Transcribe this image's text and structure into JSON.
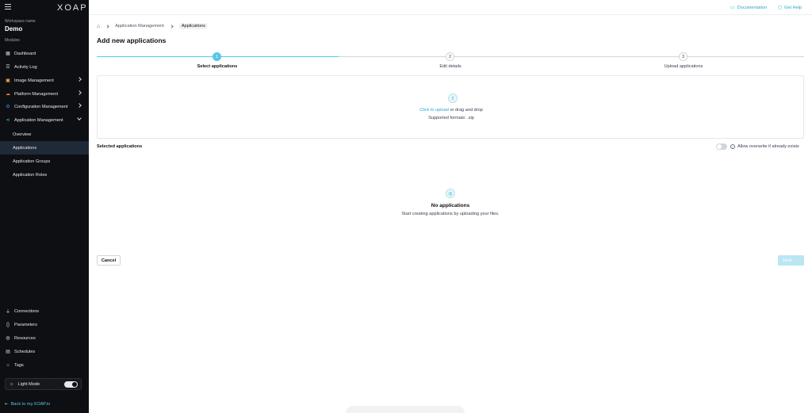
{
  "sidebar": {
    "logo": "XOAP",
    "workspace_label": "Workspace name",
    "workspace_name": "Demo",
    "modules_label": "Modules",
    "items": [
      {
        "label": "Dashboard",
        "icon": "grid-icon"
      },
      {
        "label": "Activity Log",
        "icon": "list-icon"
      },
      {
        "label": "Image Management",
        "icon": "image-icon"
      },
      {
        "label": "Platform Management",
        "icon": "cloud-icon"
      },
      {
        "label": "Configuration Management",
        "icon": "gear-icon"
      },
      {
        "label": "Application Management",
        "icon": "share-icon"
      }
    ],
    "sub_items": [
      "Overview",
      "Applications",
      "Application Groups",
      "Application Roles"
    ],
    "bottom_items": [
      {
        "label": "Connections",
        "icon": "plug-icon"
      },
      {
        "label": "Parameters",
        "icon": "brackets-icon"
      },
      {
        "label": "Resources",
        "icon": "globe-icon"
      },
      {
        "label": "Schedules",
        "icon": "calendar-icon"
      },
      {
        "label": "Tags",
        "icon": "tag-icon"
      }
    ],
    "light_mode_label": "Light Mode",
    "back_link": "Back to my.XOAP.io"
  },
  "topbar": {
    "documentation": "Documentation",
    "get_help": "Get Help"
  },
  "breadcrumb": {
    "items": [
      "Application Management",
      "Applications"
    ]
  },
  "page": {
    "title": "Add new applications"
  },
  "steps": [
    {
      "number": "1",
      "label": "Select applications"
    },
    {
      "number": "2",
      "label": "Edit details"
    },
    {
      "number": "3",
      "label": "Upload applications"
    }
  ],
  "dropzone": {
    "link_text": "Click to upload",
    "rest_text": " or drag and drop",
    "formats": "Supported formats: .zip"
  },
  "selected": {
    "label": "Selected applications",
    "overwrite_label": "Allow overwrite if already exists"
  },
  "empty": {
    "title": "No applications",
    "subtitle": "Start creating applications by uploading your files."
  },
  "actions": {
    "cancel": "Cancel",
    "next": "Next"
  },
  "colors": {
    "accent": "#56c7e6",
    "sidebar_bg": "#0e0f12",
    "link": "#2aa5cc"
  }
}
